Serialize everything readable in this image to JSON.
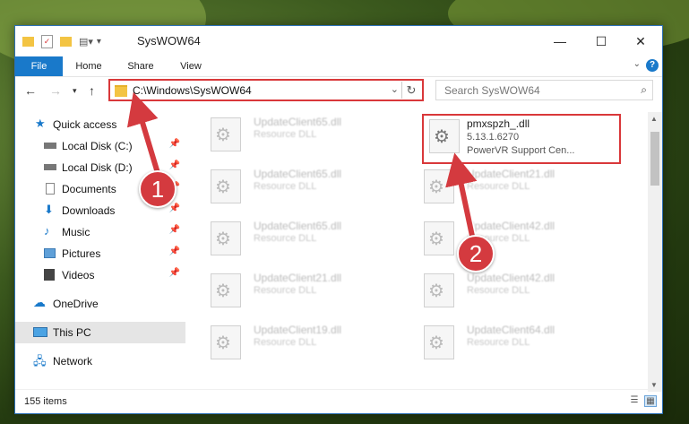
{
  "window": {
    "title": "SysWOW64"
  },
  "ribbon": {
    "tabs": [
      "File",
      "Home",
      "Share",
      "View"
    ],
    "help": "?"
  },
  "address": {
    "path": "C:\\Windows\\SysWOW64"
  },
  "search": {
    "placeholder": "Search SysWOW64"
  },
  "sidebar": {
    "items": [
      {
        "label": "Quick access",
        "icon": "star-icon"
      },
      {
        "label": "Local Disk (C:)",
        "icon": "drive-icon"
      },
      {
        "label": "Local Disk (D:)",
        "icon": "drive-icon"
      },
      {
        "label": "Documents",
        "icon": "documents-icon"
      },
      {
        "label": "Downloads",
        "icon": "download-icon"
      },
      {
        "label": "Music",
        "icon": "music-icon"
      },
      {
        "label": "Pictures",
        "icon": "pictures-icon"
      },
      {
        "label": "Videos",
        "icon": "videos-icon"
      },
      {
        "label": "OneDrive",
        "icon": "cloud-icon"
      },
      {
        "label": "This PC",
        "icon": "computer-icon"
      },
      {
        "label": "Network",
        "icon": "network-icon"
      }
    ]
  },
  "files": {
    "left": [
      {
        "name": "UpdateClient65.dll",
        "desc": "Resource DLL"
      },
      {
        "name": "UpdateClient65.dll",
        "desc": "Resource DLL"
      },
      {
        "name": "UpdateClient65.dll",
        "desc": "Resource DLL"
      },
      {
        "name": "UpdateClient21.dll",
        "desc": "Resource DLL"
      },
      {
        "name": "UpdateClient19.dll",
        "desc": "Resource DLL"
      }
    ],
    "right": [
      {
        "name": "pmxspzh_.dll",
        "version": "5.13.1.6270",
        "desc": "PowerVR Support Cen..."
      },
      {
        "name": "UpdateClient21.dll",
        "desc": "Resource DLL"
      },
      {
        "name": "UpdateClient42.dll",
        "desc": "Resource DLL"
      },
      {
        "name": "UpdateClient42.dll",
        "desc": "Resource DLL"
      },
      {
        "name": "UpdateClient64.dll",
        "desc": "Resource DLL"
      }
    ]
  },
  "status": {
    "count": "155 items"
  },
  "badges": {
    "one": "1",
    "two": "2"
  },
  "colors": {
    "accent": "#1979ca",
    "highlight": "#d9383a"
  }
}
